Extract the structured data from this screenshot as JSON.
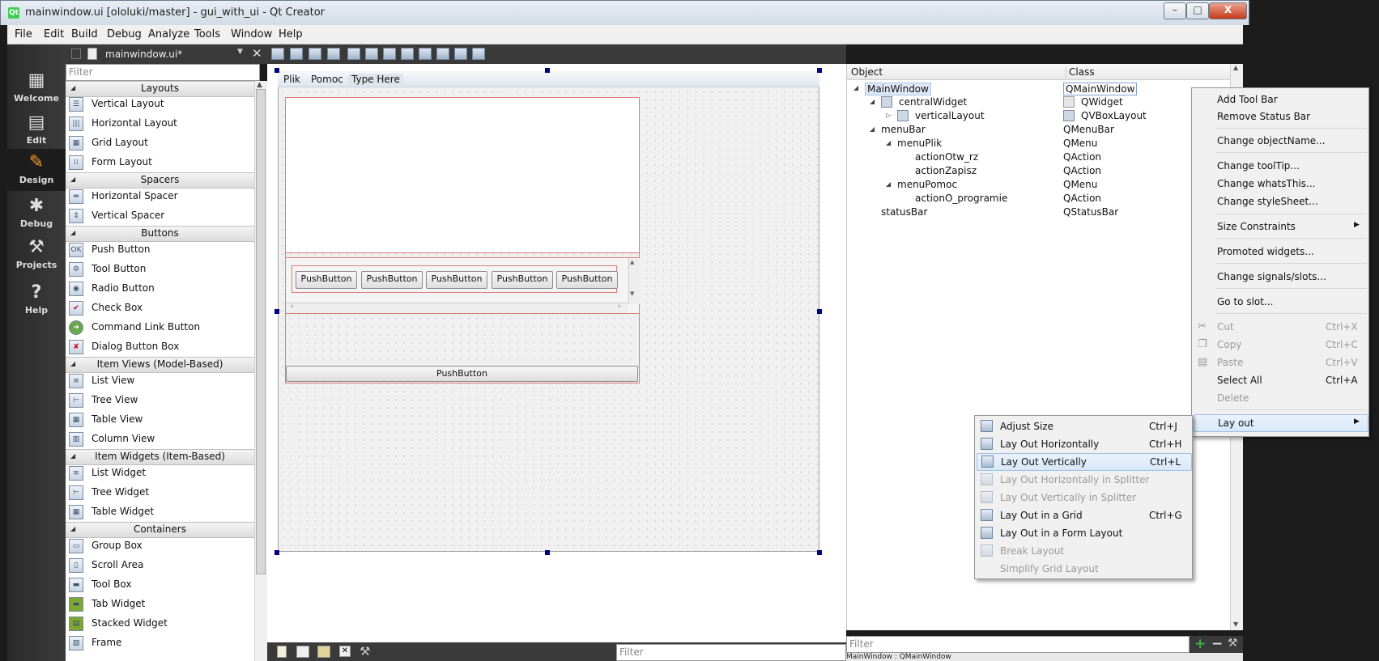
{
  "window": {
    "title": "mainwindow.ui [ololuki/master] - gui_with_ui - Qt Creator",
    "app_icon": "qt-logo",
    "controls": [
      "–",
      "□",
      "X"
    ]
  },
  "menubar": [
    "File",
    "Edit",
    "Build",
    "Debug",
    "Analyze",
    "Tools",
    "Window",
    "Help"
  ],
  "modes": [
    {
      "label": "Welcome",
      "icon": "grid-icon"
    },
    {
      "label": "Edit",
      "icon": "document-icon"
    },
    {
      "label": "Design",
      "icon": "pencil-icon",
      "active": true
    },
    {
      "label": "Debug",
      "icon": "bug-icon"
    },
    {
      "label": "Projects",
      "icon": "wrench-icon"
    },
    {
      "label": "Help",
      "icon": "help-icon"
    }
  ],
  "document_tab": {
    "filename": "mainwindow.ui*"
  },
  "widget_box": {
    "filter_placeholder": "Filter",
    "categories": {
      "layouts": "Layouts",
      "spacers": "Spacers",
      "buttons": "Buttons",
      "item_views": "Item Views (Model-Based)",
      "item_widgets": "Item Widgets (Item-Based)",
      "containers": "Containers"
    },
    "items": {
      "vertical_layout": "Vertical Layout",
      "horizontal_layout": "Horizontal Layout",
      "grid_layout": "Grid Layout",
      "form_layout": "Form Layout",
      "horizontal_spacer": "Horizontal Spacer",
      "vertical_spacer": "Vertical Spacer",
      "push_button": "Push Button",
      "tool_button": "Tool Button",
      "radio_button": "Radio Button",
      "check_box": "Check Box",
      "command_link_button": "Command Link Button",
      "dialog_button_box": "Dialog Button Box",
      "list_view": "List View",
      "tree_view": "Tree View",
      "table_view": "Table View",
      "column_view": "Column View",
      "list_widget": "List Widget",
      "tree_widget": "Tree Widget",
      "table_widget": "Table Widget",
      "group_box": "Group Box",
      "scroll_area": "Scroll Area",
      "tool_box": "Tool Box",
      "tab_widget": "Tab Widget",
      "stacked_widget": "Stacked Widget",
      "frame": "Frame"
    }
  },
  "form": {
    "menu": [
      "Plik",
      "Pomoc",
      "Type Here"
    ],
    "push_buttons": [
      "PushButton",
      "PushButton",
      "PushButton",
      "PushButton",
      "PushButton"
    ],
    "bottom_button": "PushButton"
  },
  "bottom_filter_placeholder": "Filter",
  "object_inspector": {
    "headers": {
      "object": "Object",
      "class": "Class"
    },
    "rows": [
      {
        "object": "MainWindow",
        "class": "QMainWindow"
      },
      {
        "object": "centralWidget",
        "class": "QWidget"
      },
      {
        "object": "verticalLayout",
        "class": "QVBoxLayout"
      },
      {
        "object": "menuBar",
        "class": "QMenuBar"
      },
      {
        "object": "menuPlik",
        "class": "QMenu"
      },
      {
        "object": "actionOtw_rz",
        "class": "QAction"
      },
      {
        "object": "actionZapisz",
        "class": "QAction"
      },
      {
        "object": "menuPomoc",
        "class": "QMenu"
      },
      {
        "object": "actionO_programie",
        "class": "QAction"
      },
      {
        "object": "statusBar",
        "class": "QStatusBar"
      }
    ],
    "filter_placeholder": "Filter",
    "status": "MainWindow : QMainWindow"
  },
  "context_menu": {
    "items": {
      "add_tool_bar": "Add Tool Bar",
      "remove_status_bar": "Remove Status Bar",
      "change_object_name": "Change objectName...",
      "change_tooltip": "Change toolTip...",
      "change_whats_this": "Change whatsThis...",
      "change_stylesheet": "Change styleSheet...",
      "size_constraints": "Size Constraints",
      "promoted_widgets": "Promoted widgets...",
      "change_signals_slots": "Change signals/slots...",
      "go_to_slot": "Go to slot...",
      "cut": "Cut",
      "copy": "Copy",
      "paste": "Paste",
      "select_all": "Select All",
      "delete": "Delete",
      "lay_out": "Lay out"
    },
    "shortcuts": {
      "cut": "Ctrl+X",
      "copy": "Ctrl+C",
      "paste": "Ctrl+V",
      "select_all": "Ctrl+A"
    }
  },
  "layout_submenu": {
    "items": {
      "adjust_size": "Adjust Size",
      "lay_out_horizontally": "Lay Out Horizontally",
      "lay_out_vertically": "Lay Out Vertically",
      "lay_out_horizontally_splitter": "Lay Out Horizontally in Splitter",
      "lay_out_vertically_splitter": "Lay Out Vertically in Splitter",
      "lay_out_grid": "Lay Out in a Grid",
      "lay_out_form": "Lay Out in a Form Layout",
      "break_layout": "Break Layout",
      "simplify_grid": "Simplify Grid Layout"
    },
    "shortcuts": {
      "adjust_size": "Ctrl+J",
      "lay_out_horizontally": "Ctrl+H",
      "lay_out_vertically": "Ctrl+L",
      "lay_out_grid": "Ctrl+G"
    },
    "highlighted": "lay_out_vertically"
  }
}
